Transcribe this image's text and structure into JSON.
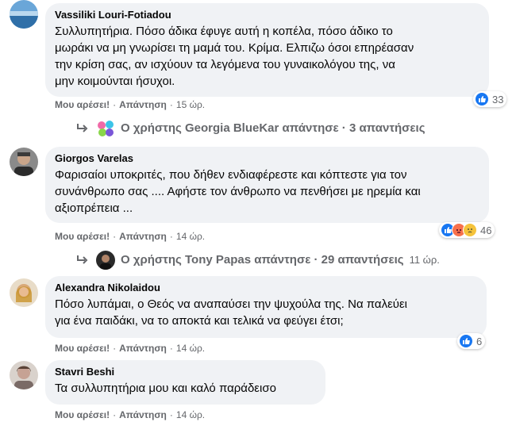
{
  "comments": [
    {
      "author": "Vassiliki Louri-Fotiadou",
      "lines": [
        "Συλλυπητήρια. Πόσο άδικα έφυγε αυτή η κοπέλα, πόσο άδικο το",
        "μωράκι να μη γνωρίσει τη μαμά του. Κρίμα. Ελπιζω όσοι επηρέασαν",
        "την κρίση σας, αν ισχύουν τα λεγόμενα του γυναικολόγου της, να",
        "μην κοιμούνται ήσυχοι."
      ],
      "like_label": "Μου αρέσει!",
      "reply_label": "Απάντηση",
      "time": "15 ώρ.",
      "reaction_count": "33",
      "reply_thread": {
        "text": "Ο χρήστης Georgia BlueKar απάντησε · 3 απαντήσεις",
        "time": ""
      }
    },
    {
      "author": "Giorgos Varelas",
      "lines": [
        "Φαρισαίοι υποκριτές, που δήθεν ενδιαφέρεστε και κόπτεστε για τον",
        "συνάνθρωπο σας .... Αφήστε τον άνθρωπο να πενθήσει με ηρεμία και",
        "αξιοπρέπεια ..."
      ],
      "like_label": "Μου αρέσει!",
      "reply_label": "Απάντηση",
      "time": "14 ώρ.",
      "reaction_count": "46",
      "reply_thread": {
        "text": "Ο χρήστης Tony Papas απάντησε · 29 απαντήσεις",
        "time": "11 ώρ."
      }
    },
    {
      "author": "Alexandra Nikolaidou",
      "lines": [
        "Πόσο λυπάμαι, ο Θεός να αναπαύσει την ψυχούλα της. Να παλεύει",
        "για ένα παιδάκι, να το αποκτά και τελικά να φεύγει έτσι;"
      ],
      "like_label": "Μου αρέσει!",
      "reply_label": "Απάντηση",
      "time": "14 ώρ.",
      "reaction_count": "6"
    },
    {
      "author": "Stavri Beshi",
      "lines": [
        "Τα συλλυπητήρια μου και καλό παράδεισο"
      ],
      "like_label": "Μου αρέσει!",
      "reply_label": "Απάντηση",
      "time": "14 ώρ."
    }
  ],
  "colors": {
    "like_blue": "#1877f2",
    "angry_orange": "#f7714c",
    "bubble_bg": "#f0f2f5",
    "meta_gray": "#65676b"
  },
  "icons": {
    "like": "like-reaction-icon",
    "angry": "angry-reaction-icon",
    "reply_arrow": "reply-arrow-icon"
  }
}
